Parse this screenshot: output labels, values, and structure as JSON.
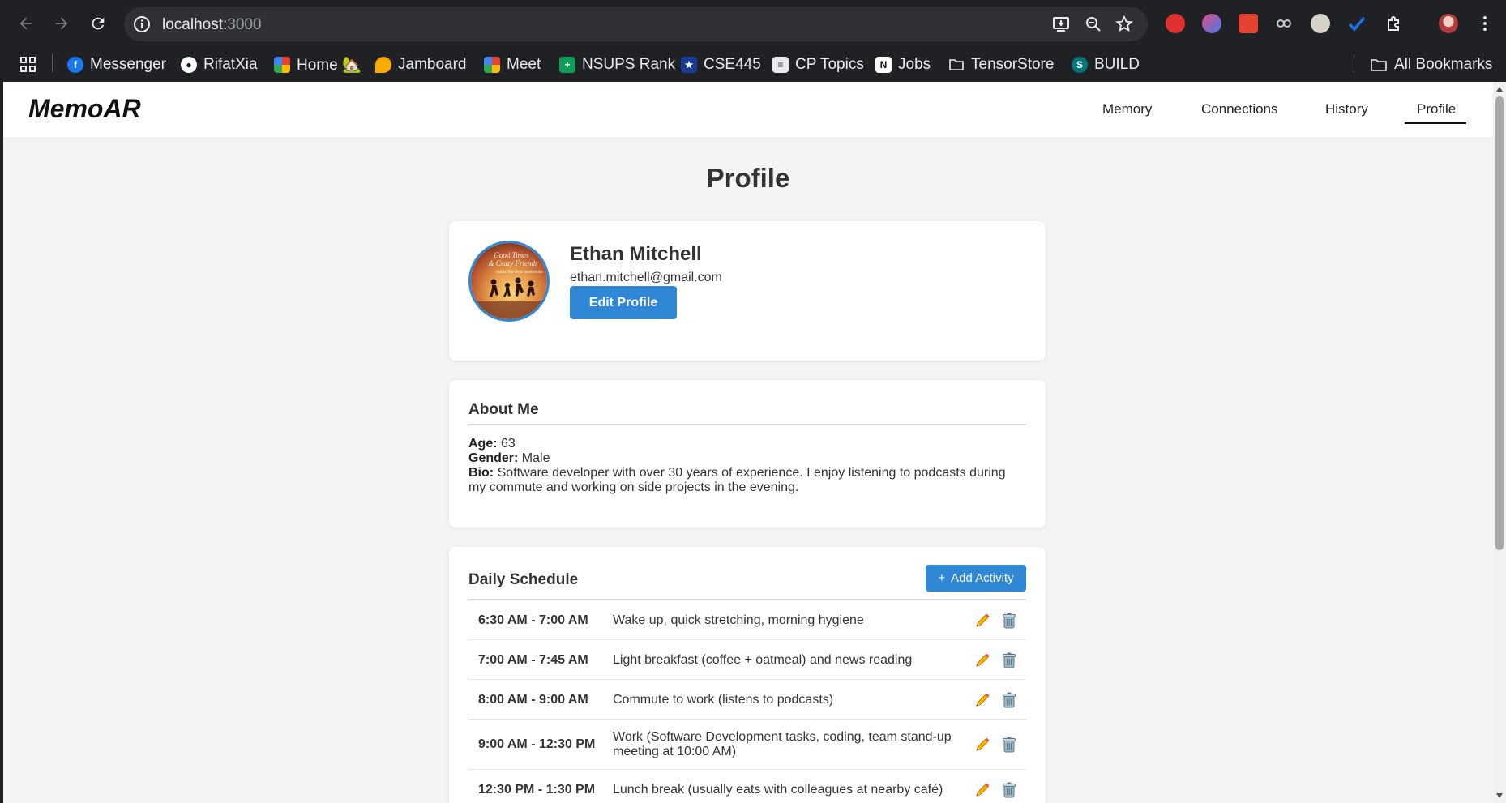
{
  "browser": {
    "url_host": "localhost:",
    "url_port": "3000",
    "bookmarks": [
      {
        "label": "Messenger",
        "icon": "messenger-icon",
        "color": "#1877f2"
      },
      {
        "label": "RifatXia",
        "icon": "github-icon",
        "color": "#ffffff"
      },
      {
        "label": "Home 🏡",
        "icon": "meet-icon",
        "color": "#34a853"
      },
      {
        "label": "Jamboard",
        "icon": "jamboard-icon",
        "color": "#f9ab00"
      },
      {
        "label": "Meet",
        "icon": "meet-icon",
        "color": "#34a853"
      },
      {
        "label": "NSUPS Rank",
        "icon": "sheets-icon",
        "color": "#0f9d58"
      },
      {
        "label": "CSE445",
        "icon": "star-icon",
        "color": "#1a3a8f"
      },
      {
        "label": "CP Topics",
        "icon": "doc-icon",
        "color": "#e8eaed"
      },
      {
        "label": "Jobs",
        "icon": "notion-icon",
        "color": "#ffffff"
      },
      {
        "label": "TensorStore",
        "icon": "folder-icon",
        "color": "#e8eaed"
      },
      {
        "label": "BUILD",
        "icon": "sharepoint-icon",
        "color": "#03787c"
      }
    ],
    "all_bookmarks": "All Bookmarks"
  },
  "app": {
    "logo": "MemoAR",
    "nav": [
      {
        "label": "Memory"
      },
      {
        "label": "Connections"
      },
      {
        "label": "History"
      },
      {
        "label": "Profile",
        "active": true
      }
    ]
  },
  "page": {
    "title": "Profile"
  },
  "profile": {
    "name": "Ethan Mitchell",
    "email": "ethan.mitchell@gmail.com",
    "edit_label": "Edit Profile",
    "avatar_text": "Good Times & Crazy Friends make the best memories"
  },
  "about": {
    "title": "About Me",
    "age_label": "Age:",
    "age": "63",
    "gender_label": "Gender:",
    "gender": "Male",
    "bio_label": "Bio:",
    "bio": "Software developer with over 30 years of experience. I enjoy listening to podcasts during my commute and working on side projects in the evening."
  },
  "schedule": {
    "title": "Daily Schedule",
    "add_label": "Add Activity",
    "items": [
      {
        "time": "6:30 AM - 7:00 AM",
        "activity": "Wake up, quick stretching, morning hygiene"
      },
      {
        "time": "7:00 AM - 7:45 AM",
        "activity": "Light breakfast (coffee + oatmeal) and news reading"
      },
      {
        "time": "8:00 AM - 9:00 AM",
        "activity": "Commute to work (listens to podcasts)"
      },
      {
        "time": "9:00 AM - 12:30 PM",
        "activity": "Work (Software Development tasks, coding, team stand-up meeting at 10:00 AM)"
      },
      {
        "time": "12:30 PM - 1:30 PM",
        "activity": "Lunch break (usually eats with colleagues at nearby café)"
      }
    ]
  },
  "colors": {
    "accent": "#2f87d6",
    "page_bg": "#f4f4f4"
  }
}
